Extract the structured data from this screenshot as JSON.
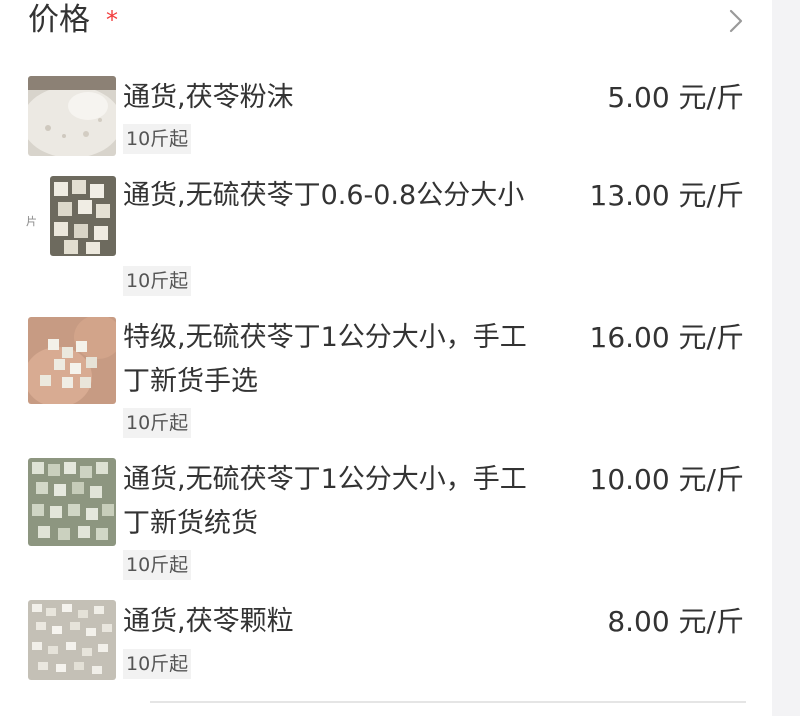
{
  "header": {
    "title": "价格",
    "required_mark": "*"
  },
  "items": [
    {
      "name": "通货,茯苓粉沫",
      "price": "5.00 元/斤",
      "moq": "10斤起",
      "thumb_icon": "powder-photo"
    },
    {
      "name": "通货,无硫茯苓丁0.6-0.8公分大小",
      "price": "13.00 元/斤",
      "moq": "10斤起",
      "thumb_icon": "cubes-photo"
    },
    {
      "name": "特级,无硫茯苓丁1公分大小，手工丁新货手选",
      "price": "16.00 元/斤",
      "moq": "10斤起",
      "thumb_icon": "hand-cubes-photo"
    },
    {
      "name": "通货,无硫茯苓丁1公分大小，手工丁新货统货",
      "price": "10.00 元/斤",
      "moq": "10斤起",
      "thumb_icon": "green-cubes-photo"
    },
    {
      "name": "通货,茯苓颗粒",
      "price": "8.00 元/斤",
      "moq": "10斤起",
      "thumb_icon": "granules-photo"
    }
  ],
  "side_mark": "片",
  "colors": {
    "required": "#f23c3c",
    "tag_bg": "#f2f2f2"
  }
}
